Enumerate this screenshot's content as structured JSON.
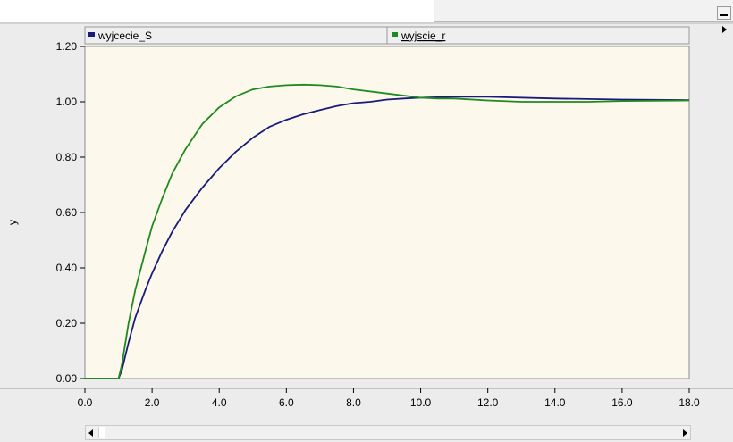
{
  "window": {
    "minimize_icon": "minimize-icon"
  },
  "chart_data": {
    "type": "line",
    "xlabel": "",
    "ylabel": "y",
    "xlim": [
      0,
      18
    ],
    "ylim": [
      0,
      1.2
    ],
    "x_ticks": [
      "0.0",
      "2.0",
      "4.0",
      "6.0",
      "8.0",
      "10.0",
      "12.0",
      "14.0",
      "16.0",
      "18.0"
    ],
    "y_ticks": [
      "0.00",
      "0.20",
      "0.40",
      "0.60",
      "0.80",
      "1.00",
      "1.20"
    ],
    "grid": false,
    "legend_position": "top",
    "plot_background": "#fcf9ec",
    "series": [
      {
        "name": "wyjcecie_S",
        "color": "#1a1a7a",
        "x": [
          0,
          1.0,
          1.1,
          1.3,
          1.5,
          1.8,
          2.0,
          2.3,
          2.6,
          3.0,
          3.5,
          4.0,
          4.5,
          5.0,
          5.5,
          6.0,
          6.5,
          7.0,
          7.5,
          8.0,
          8.5,
          9.0,
          9.5,
          10.0,
          11.0,
          12.0,
          14.0,
          16.0,
          18.0
        ],
        "values": [
          0,
          0,
          0.03,
          0.13,
          0.22,
          0.32,
          0.38,
          0.46,
          0.53,
          0.61,
          0.69,
          0.76,
          0.82,
          0.87,
          0.91,
          0.935,
          0.955,
          0.97,
          0.985,
          0.995,
          1.0,
          1.008,
          1.012,
          1.015,
          1.018,
          1.018,
          1.012,
          1.008,
          1.006
        ]
      },
      {
        "name": "wyjscie_r",
        "color": "#1f8a1f",
        "x": [
          0,
          1.0,
          1.1,
          1.3,
          1.5,
          1.8,
          2.0,
          2.3,
          2.6,
          3.0,
          3.5,
          4.0,
          4.5,
          5.0,
          5.5,
          6.0,
          6.5,
          7.0,
          7.5,
          8.0,
          9.0,
          10.0,
          10.5,
          11.0,
          12.0,
          13.0,
          14.0,
          15.0,
          16.0,
          18.0
        ],
        "values": [
          0,
          0,
          0.05,
          0.2,
          0.32,
          0.46,
          0.55,
          0.65,
          0.74,
          0.83,
          0.92,
          0.98,
          1.02,
          1.045,
          1.055,
          1.06,
          1.062,
          1.06,
          1.055,
          1.045,
          1.03,
          1.015,
          1.012,
          1.012,
          1.005,
          1.0,
          1.0,
          1.0,
          1.003,
          1.005
        ]
      }
    ]
  }
}
